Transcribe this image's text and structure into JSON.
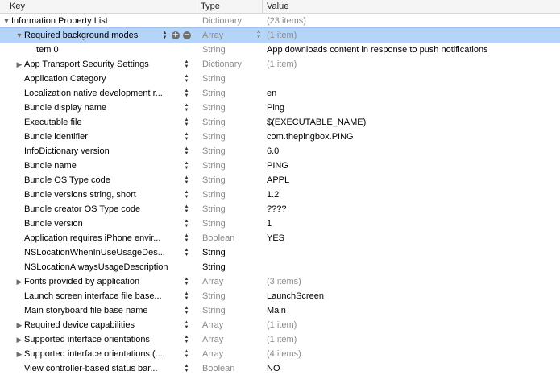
{
  "columns": {
    "key": "Key",
    "type": "Type",
    "value": "Value"
  },
  "rows": [
    {
      "key": "Information Property List",
      "type": "Dictionary",
      "value": "(23 items)",
      "indent": 0,
      "disclosure": "open",
      "stepper": false,
      "value_dim": true,
      "type_strong": false,
      "selected": false
    },
    {
      "key": "Required background modes",
      "type": "Array",
      "value": "(1 item)",
      "indent": 1,
      "disclosure": "open",
      "stepper": true,
      "add_remove": true,
      "type_popup": true,
      "value_dim": true,
      "type_strong": false,
      "selected": true
    },
    {
      "key": "Item 0",
      "type": "String",
      "value": "App downloads content in response to push notifications",
      "indent": 2,
      "disclosure": "none",
      "stepper": false,
      "value_dim": false,
      "type_strong": false,
      "selected": false
    },
    {
      "key": "App Transport Security Settings",
      "type": "Dictionary",
      "value": "(1 item)",
      "indent": 1,
      "disclosure": "closed",
      "stepper": true,
      "value_dim": true,
      "type_strong": false,
      "selected": false
    },
    {
      "key": "Application Category",
      "type": "String",
      "value": "",
      "indent": 1,
      "disclosure": "none",
      "stepper": true,
      "value_dim": false,
      "type_strong": false,
      "selected": false
    },
    {
      "key": "Localization native development r...",
      "type": "String",
      "value": "en",
      "indent": 1,
      "disclosure": "none",
      "stepper": true,
      "value_dim": false,
      "type_strong": false,
      "selected": false
    },
    {
      "key": "Bundle display name",
      "type": "String",
      "value": "Ping",
      "indent": 1,
      "disclosure": "none",
      "stepper": true,
      "value_dim": false,
      "type_strong": false,
      "selected": false
    },
    {
      "key": "Executable file",
      "type": "String",
      "value": "$(EXECUTABLE_NAME)",
      "indent": 1,
      "disclosure": "none",
      "stepper": true,
      "value_dim": false,
      "type_strong": false,
      "selected": false
    },
    {
      "key": "Bundle identifier",
      "type": "String",
      "value": "com.thepingbox.PING",
      "indent": 1,
      "disclosure": "none",
      "stepper": true,
      "value_dim": false,
      "type_strong": false,
      "selected": false
    },
    {
      "key": "InfoDictionary version",
      "type": "String",
      "value": "6.0",
      "indent": 1,
      "disclosure": "none",
      "stepper": true,
      "value_dim": false,
      "type_strong": false,
      "selected": false
    },
    {
      "key": "Bundle name",
      "type": "String",
      "value": "PING",
      "indent": 1,
      "disclosure": "none",
      "stepper": true,
      "value_dim": false,
      "type_strong": false,
      "selected": false
    },
    {
      "key": "Bundle OS Type code",
      "type": "String",
      "value": "APPL",
      "indent": 1,
      "disclosure": "none",
      "stepper": true,
      "value_dim": false,
      "type_strong": false,
      "selected": false
    },
    {
      "key": "Bundle versions string, short",
      "type": "String",
      "value": "1.2",
      "indent": 1,
      "disclosure": "none",
      "stepper": true,
      "value_dim": false,
      "type_strong": false,
      "selected": false
    },
    {
      "key": "Bundle creator OS Type code",
      "type": "String",
      "value": "????",
      "indent": 1,
      "disclosure": "none",
      "stepper": true,
      "value_dim": false,
      "type_strong": false,
      "selected": false
    },
    {
      "key": "Bundle version",
      "type": "String",
      "value": "1",
      "indent": 1,
      "disclosure": "none",
      "stepper": true,
      "value_dim": false,
      "type_strong": false,
      "selected": false
    },
    {
      "key": "Application requires iPhone envir...",
      "type": "Boolean",
      "value": "YES",
      "indent": 1,
      "disclosure": "none",
      "stepper": true,
      "value_dim": false,
      "type_strong": false,
      "selected": false
    },
    {
      "key": "NSLocationWhenInUseUsageDes...",
      "type": "String",
      "value": "",
      "indent": 1,
      "disclosure": "none",
      "stepper": true,
      "value_dim": false,
      "type_strong": true,
      "selected": false
    },
    {
      "key": "NSLocationAlwaysUsageDescription",
      "type": "String",
      "value": "",
      "indent": 1,
      "disclosure": "none",
      "stepper": false,
      "value_dim": false,
      "type_strong": true,
      "selected": false
    },
    {
      "key": "Fonts provided by application",
      "type": "Array",
      "value": "(3 items)",
      "indent": 1,
      "disclosure": "closed",
      "stepper": true,
      "value_dim": true,
      "type_strong": false,
      "selected": false
    },
    {
      "key": "Launch screen interface file base...",
      "type": "String",
      "value": "LaunchScreen",
      "indent": 1,
      "disclosure": "none",
      "stepper": true,
      "value_dim": false,
      "type_strong": false,
      "selected": false
    },
    {
      "key": "Main storyboard file base name",
      "type": "String",
      "value": "Main",
      "indent": 1,
      "disclosure": "none",
      "stepper": true,
      "value_dim": false,
      "type_strong": false,
      "selected": false
    },
    {
      "key": "Required device capabilities",
      "type": "Array",
      "value": "(1 item)",
      "indent": 1,
      "disclosure": "closed",
      "stepper": true,
      "value_dim": true,
      "type_strong": false,
      "selected": false
    },
    {
      "key": "Supported interface orientations",
      "type": "Array",
      "value": "(1 item)",
      "indent": 1,
      "disclosure": "closed",
      "stepper": true,
      "value_dim": true,
      "type_strong": false,
      "selected": false
    },
    {
      "key": "Supported interface orientations (...",
      "type": "Array",
      "value": "(4 items)",
      "indent": 1,
      "disclosure": "closed",
      "stepper": true,
      "value_dim": true,
      "type_strong": false,
      "selected": false
    },
    {
      "key": "View controller-based status bar...",
      "type": "Boolean",
      "value": "NO",
      "indent": 1,
      "disclosure": "none",
      "stepper": true,
      "value_dim": false,
      "type_strong": false,
      "selected": false
    }
  ],
  "colors": {
    "selection": "#b5d5f8",
    "dim_text": "#8b8b8b",
    "header_bg": "#f5f5f5"
  }
}
